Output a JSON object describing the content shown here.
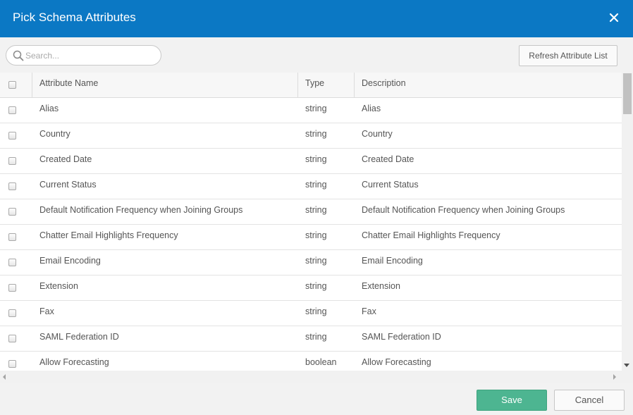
{
  "dialog": {
    "title": "Pick Schema Attributes",
    "close_icon": "close-icon"
  },
  "toolbar": {
    "search_placeholder": "Search...",
    "search_value": "",
    "refresh_label": "Refresh Attribute List"
  },
  "table": {
    "columns": [
      "Attribute Name",
      "Type",
      "Description"
    ],
    "rows": [
      {
        "name": "Alias",
        "type": "string",
        "description": "Alias"
      },
      {
        "name": "Country",
        "type": "string",
        "description": "Country"
      },
      {
        "name": "Created Date",
        "type": "string",
        "description": "Created Date"
      },
      {
        "name": "Current Status",
        "type": "string",
        "description": "Current Status"
      },
      {
        "name": "Default Notification Frequency when Joining Groups",
        "type": "string",
        "description": "Default Notification Frequency when Joining Groups"
      },
      {
        "name": "Chatter Email Highlights Frequency",
        "type": "string",
        "description": "Chatter Email Highlights Frequency"
      },
      {
        "name": "Email Encoding",
        "type": "string",
        "description": "Email Encoding"
      },
      {
        "name": "Extension",
        "type": "string",
        "description": "Extension"
      },
      {
        "name": "Fax",
        "type": "string",
        "description": "Fax"
      },
      {
        "name": "SAML Federation ID",
        "type": "string",
        "description": "SAML Federation ID"
      },
      {
        "name": "Allow Forecasting",
        "type": "boolean",
        "description": "Allow Forecasting"
      }
    ]
  },
  "footer": {
    "save_label": "Save",
    "cancel_label": "Cancel"
  },
  "colors": {
    "titlebar": "#0b78c4",
    "save_button": "#4db591"
  }
}
